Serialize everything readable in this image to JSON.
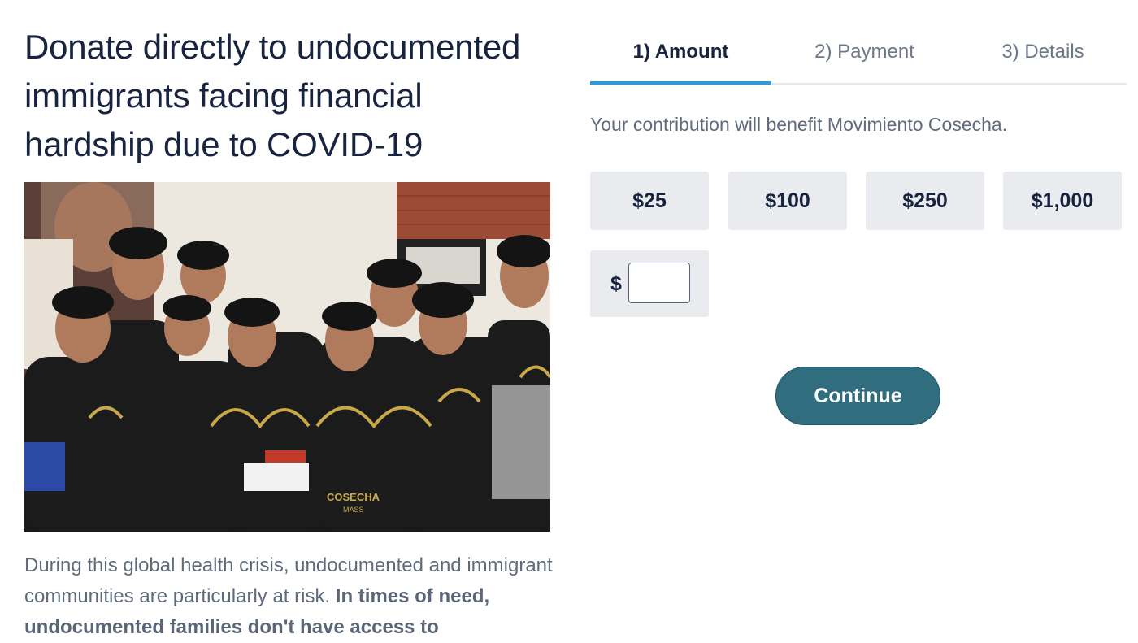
{
  "campaign": {
    "title": "Donate directly to undocumented immigrants facing financial hardship due to COVID-19",
    "intro_plain": "During this global health crisis, undocumented and immigrant communities are particularly at risk. ",
    "intro_bold": "In times of need, undocumented families don't have access to"
  },
  "photo_print": {
    "shirt_brand": "COSECHA",
    "shirt_sub": "MASS"
  },
  "steps": {
    "tabs": [
      {
        "label": "1) Amount",
        "active": true
      },
      {
        "label": "2) Payment",
        "active": false
      },
      {
        "label": "3) Details",
        "active": false
      }
    ]
  },
  "donation": {
    "benefit_text": "Your contribution will benefit Movimiento Cosecha.",
    "amounts": [
      "$25",
      "$100",
      "$250",
      "$1,000"
    ],
    "custom_currency": "$",
    "custom_value": "",
    "continue_label": "Continue"
  },
  "colors": {
    "active_tab_underline": "#2e9ad6",
    "continue_button": "#2f6d7f",
    "amount_button_bg": "#eaebee",
    "heading_text": "#17233f",
    "body_text": "#5f6b7d"
  }
}
